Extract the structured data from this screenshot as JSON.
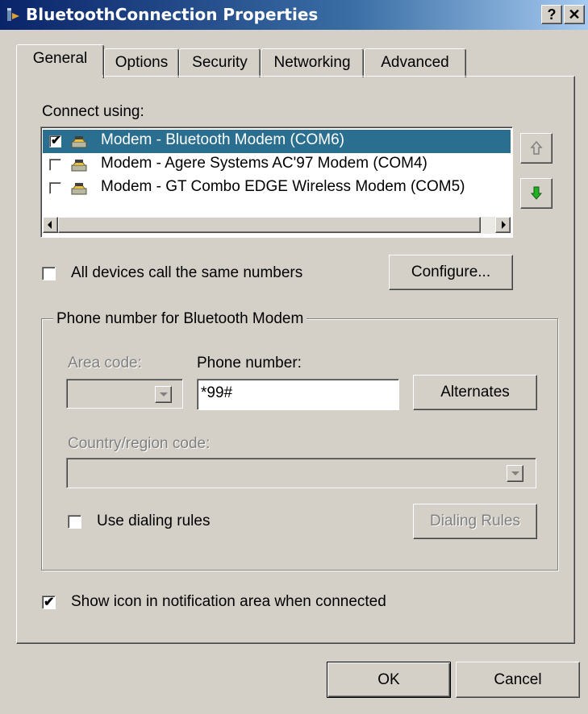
{
  "window": {
    "title": "BluetoothConnection Properties",
    "help_label": "?",
    "close_label": "✕"
  },
  "tabs": [
    {
      "label": "General"
    },
    {
      "label": "Options"
    },
    {
      "label": "Security"
    },
    {
      "label": "Networking"
    },
    {
      "label": "Advanced"
    }
  ],
  "connect": {
    "label": "Connect using:",
    "devices": [
      {
        "label": "Modem - Bluetooth Modem (COM6)",
        "checked": true,
        "selected": true
      },
      {
        "label": "Modem - Agere Systems AC'97 Modem (COM4)",
        "checked": false,
        "selected": false
      },
      {
        "label": "Modem - GT Combo EDGE Wireless Modem (COM5)",
        "checked": false,
        "selected": false
      }
    ]
  },
  "all_devices": {
    "label": "All devices call the same numbers",
    "checked": false
  },
  "configure_label": "Configure...",
  "phone_group": {
    "legend": "Phone number for Bluetooth Modem",
    "area_code_label": "Area code:",
    "area_code_value": "",
    "phone_label": "Phone number:",
    "phone_value": "*99#",
    "alternates_label": "Alternates",
    "country_label": "Country/region code:",
    "country_value": "",
    "dialing_rules_checkbox": "Use dialing rules",
    "dialing_rules_checked": false,
    "dialing_rules_button": "Dialing Rules"
  },
  "show_icon": {
    "label": "Show icon in notification area when connected",
    "checked": true
  },
  "footer": {
    "ok_label": "OK",
    "cancel_label": "Cancel"
  },
  "colors": {
    "selection": "#2a6f8f",
    "title_start": "#0a246a",
    "face": "#d4d0c8"
  }
}
